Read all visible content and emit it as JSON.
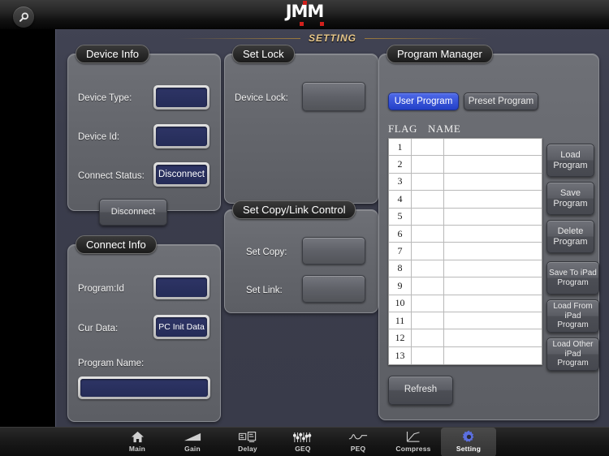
{
  "header": {
    "logo": "JMM",
    "search_icon": "search-icon",
    "page_title": "SETTING"
  },
  "device_info": {
    "title": "Device Info",
    "device_type_label": "Device Type:",
    "device_type_value": "",
    "device_id_label": "Device Id:",
    "device_id_value": "",
    "connect_status_label": "Connect Status:",
    "connect_status_value": "Disconnect",
    "disconnect_button": "Disconnect"
  },
  "connect_info": {
    "title": "Connect Info",
    "program_id_label": "Program:Id",
    "program_id_value": "",
    "cur_data_label": "Cur Data:",
    "cur_data_value": "PC Init Data",
    "program_name_label": "Program Name:",
    "program_name_value": ""
  },
  "set_lock": {
    "title": "Set Lock",
    "device_lock_label": "Device Lock:",
    "device_lock_value": ""
  },
  "set_copy_link": {
    "title": "Set Copy/Link Control",
    "set_copy_label": "Set Copy:",
    "set_copy_value": "",
    "set_link_label": "Set Link:",
    "set_link_value": ""
  },
  "program_manager": {
    "title": "Program Manager",
    "tabs": [
      {
        "label": "User Program",
        "active": true
      },
      {
        "label": "Preset Program",
        "active": false
      }
    ],
    "columns": {
      "flag": "FLAG",
      "name": "NAME"
    },
    "rows": [
      {
        "index": "1",
        "flag": "",
        "name": ""
      },
      {
        "index": "2",
        "flag": "",
        "name": ""
      },
      {
        "index": "3",
        "flag": "",
        "name": ""
      },
      {
        "index": "4",
        "flag": "",
        "name": ""
      },
      {
        "index": "5",
        "flag": "",
        "name": ""
      },
      {
        "index": "6",
        "flag": "",
        "name": ""
      },
      {
        "index": "7",
        "flag": "",
        "name": ""
      },
      {
        "index": "8",
        "flag": "",
        "name": ""
      },
      {
        "index": "9",
        "flag": "",
        "name": ""
      },
      {
        "index": "10",
        "flag": "",
        "name": ""
      },
      {
        "index": "11",
        "flag": "",
        "name": ""
      },
      {
        "index": "12",
        "flag": "",
        "name": ""
      },
      {
        "index": "13",
        "flag": "",
        "name": ""
      }
    ],
    "actions": [
      "Load\nProgram",
      "Save\nProgram",
      "Delete\nProgram",
      "Save To iPad\nProgram",
      "Load From iPad\nProgram",
      "Load Other iPad\nProgram"
    ],
    "action_lines": [
      [
        "Load",
        "Program"
      ],
      [
        "Save",
        "Program"
      ],
      [
        "Delete",
        "Program"
      ],
      [
        "Save To iPad",
        "Program"
      ],
      [
        "Load From iPad",
        "Program"
      ],
      [
        "Load Other iPad",
        "Program"
      ]
    ],
    "refresh_button": "Refresh"
  },
  "tabbar": {
    "items": [
      {
        "label": "Main",
        "icon": "home-icon",
        "active": false
      },
      {
        "label": "Gain",
        "icon": "ramp-icon",
        "active": false
      },
      {
        "label": "Delay",
        "icon": "delay-icon",
        "active": false
      },
      {
        "label": "GEQ",
        "icon": "sliders-icon",
        "active": false
      },
      {
        "label": "PEQ",
        "icon": "curve-icon",
        "active": false
      },
      {
        "label": "Compress",
        "icon": "compress-icon",
        "active": false
      },
      {
        "label": "Setting",
        "icon": "gear-icon",
        "active": true
      }
    ]
  },
  "colors": {
    "accent_blue": "#2340c8",
    "field_navy": "#2e3566",
    "title_gold": "#e8c88a",
    "logo_red": "#d0201c",
    "gear_blue": "#5b6fe0",
    "background": "#3b3d4c"
  }
}
